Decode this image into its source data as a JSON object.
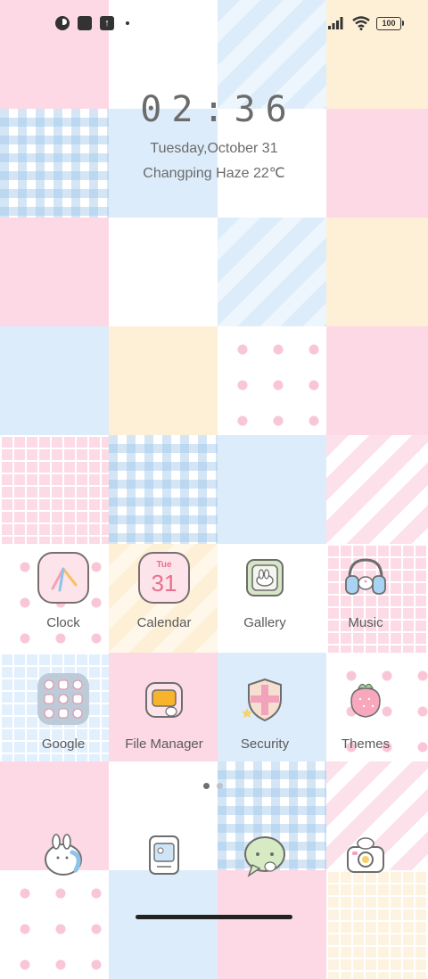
{
  "status_bar": {
    "left_icons": [
      "app-notification-icon",
      "square-notification-icon",
      "upload-icon",
      "more-dot-icon"
    ],
    "right_icons": [
      "signal-icon",
      "wifi-icon",
      "battery-icon"
    ],
    "battery_level": "100"
  },
  "clock_widget": {
    "time": "02:36",
    "date": "Tuesday,October 31",
    "weather": "Changping Haze 22℃"
  },
  "apps": [
    {
      "label": "Clock",
      "icon": "clock-icon"
    },
    {
      "label": "Calendar",
      "icon": "calendar-icon",
      "icon_day": "Tue",
      "icon_date": "31"
    },
    {
      "label": "Gallery",
      "icon": "gallery-icon"
    },
    {
      "label": "Music",
      "icon": "music-icon"
    },
    {
      "label": "Google",
      "icon": "google-folder-icon"
    },
    {
      "label": "File Manager",
      "icon": "file-manager-icon"
    },
    {
      "label": "Security",
      "icon": "security-icon"
    },
    {
      "label": "Themes",
      "icon": "themes-icon"
    }
  ],
  "dock": [
    {
      "icon": "phone-icon"
    },
    {
      "icon": "contacts-icon"
    },
    {
      "icon": "messages-icon"
    },
    {
      "icon": "camera-icon"
    }
  ],
  "pager": {
    "pages": 2,
    "active": 1
  },
  "colors": {
    "text": "#6b6b6b",
    "pink": "#fcd9e4",
    "blue": "#dcecfa",
    "yellow": "#fdf0d6"
  }
}
